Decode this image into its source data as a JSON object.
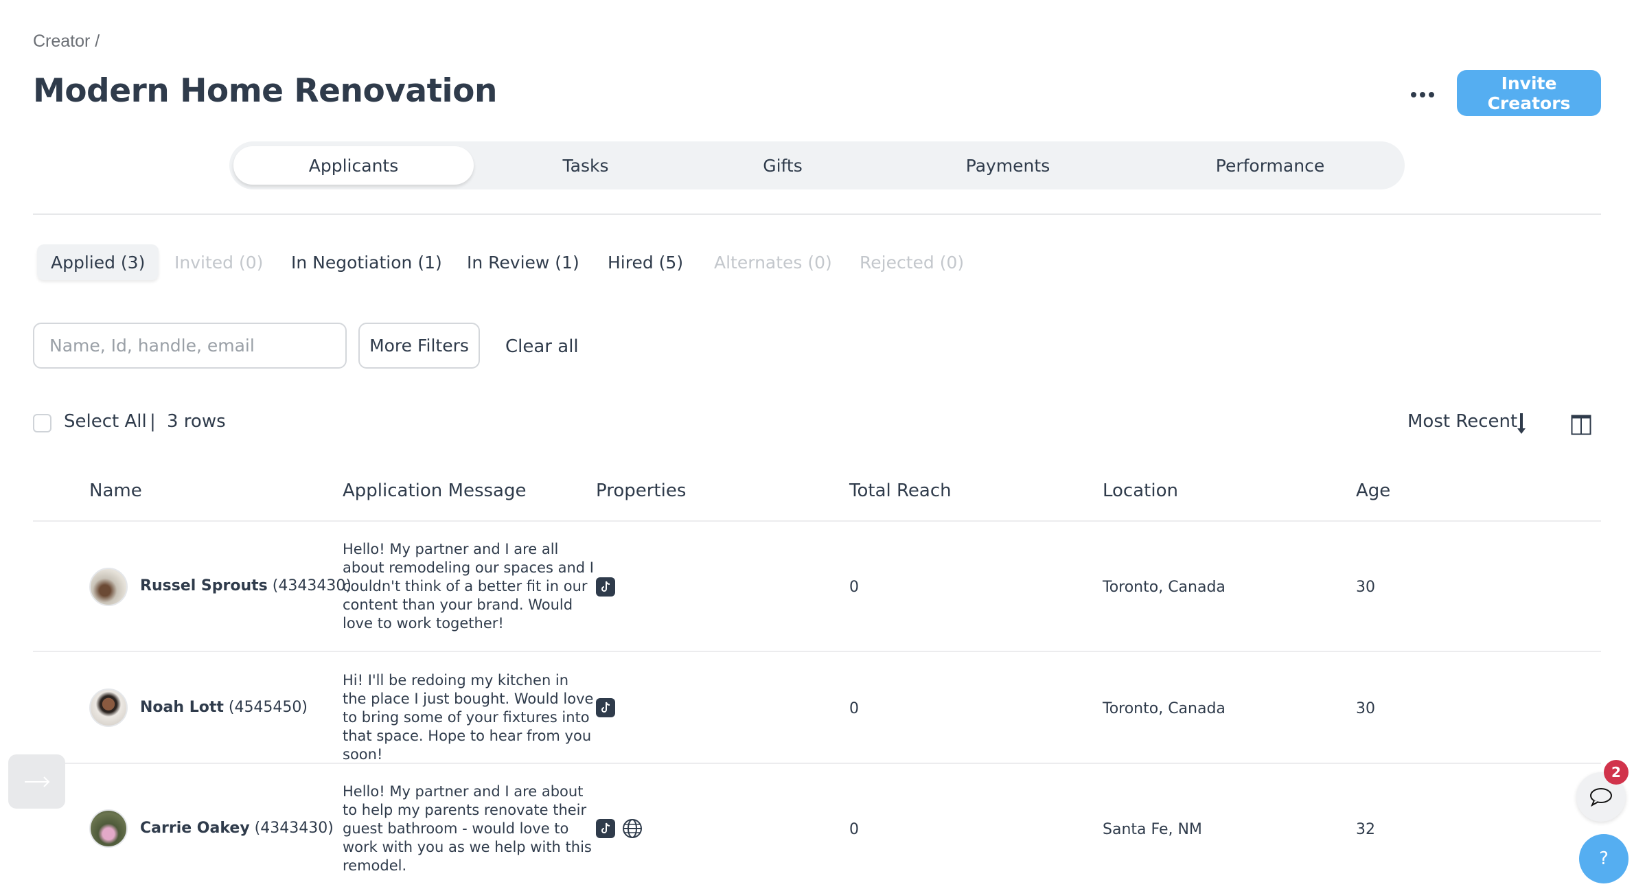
{
  "breadcrumb": "Creator /",
  "title": "Modern Home Renovation",
  "header": {
    "more_icon": "ellipsis-icon",
    "invite_label": "Invite Creators",
    "accent_color": "#55aef1"
  },
  "main_tabs": [
    {
      "label": "Applicants",
      "active": true
    },
    {
      "label": "Tasks",
      "active": false
    },
    {
      "label": "Gifts",
      "active": false
    },
    {
      "label": "Payments",
      "active": false
    },
    {
      "label": "Performance",
      "active": false
    }
  ],
  "status_tabs": [
    {
      "label": "Applied (3)",
      "state": "active"
    },
    {
      "label": "Invited (0)",
      "state": "disabled"
    },
    {
      "label": "In Negotiation (1)",
      "state": "normal"
    },
    {
      "label": "In Review (1)",
      "state": "normal"
    },
    {
      "label": "Hired (5)",
      "state": "normal"
    },
    {
      "label": "Alternates (0)",
      "state": "disabled"
    },
    {
      "label": "Rejected (0)",
      "state": "disabled"
    }
  ],
  "filters": {
    "search_placeholder": "Name, Id, handle, email",
    "search_value": "",
    "more_filters_label": "More Filters",
    "clear_all_label": "Clear all"
  },
  "selection": {
    "select_all_label": "Select All",
    "separator": "|",
    "row_count": "3 rows",
    "checked": false
  },
  "sort": {
    "label": "Most Recent",
    "direction_icon": "arrow-down-icon",
    "columns_icon": "columns-icon"
  },
  "table": {
    "columns": [
      "Name",
      "Application Message",
      "Properties",
      "Total Reach",
      "Location",
      "Age"
    ],
    "rows": [
      {
        "name": "Russel Sprouts",
        "id": "(4343430)",
        "message": "Hello! My partner and I are all about remodeling our spaces and I couldn't think of a better fit in our content than your brand. Would love to work together!",
        "properties": [
          "tiktok-icon"
        ],
        "total_reach": "0",
        "location": "Toronto, Canada",
        "age": "30"
      },
      {
        "name": "Noah Lott",
        "id": "(4545450)",
        "message": "Hi! I'll be redoing my kitchen in the place I just bought. Would love to bring some of your fixtures into that space. Hope to hear from you soon!",
        "properties": [
          "tiktok-icon"
        ],
        "total_reach": "0",
        "location": "Toronto, Canada",
        "age": "30"
      },
      {
        "name": "Carrie Oakey",
        "id": "(4343430)",
        "message": "Hello! My partner and I are about to help my parents renovate their guest bathroom - would love to work with you as we help with this remodel.",
        "properties": [
          "tiktok-icon",
          "globe-icon"
        ],
        "total_reach": "0",
        "location": "Santa Fe, NM",
        "age": "32"
      }
    ]
  },
  "widgets": {
    "chat_badge_count": "2",
    "help_label": "?",
    "badge_color": "#d1334b"
  }
}
